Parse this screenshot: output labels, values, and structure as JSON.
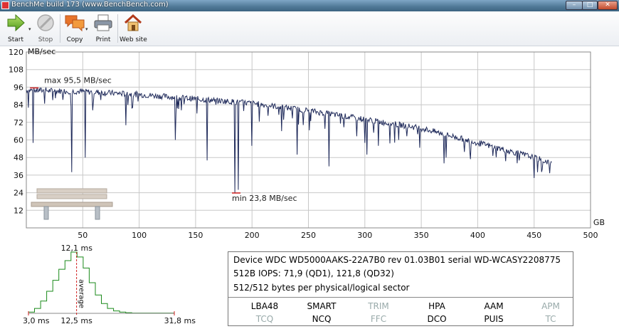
{
  "window": {
    "title": "BenchMe build 173 (www.BenchBench.com)",
    "min_label": "–",
    "max_label": "□",
    "close_label": "✕"
  },
  "toolbar": {
    "start": "Start",
    "stop": "Stop",
    "copy": "Copy",
    "print": "Print",
    "website": "Web site"
  },
  "colors": {
    "grid": "#c8c8c8",
    "series": "#1f2a5a",
    "marker": "#d02020",
    "histogram": "#1a8a1a",
    "average": "#d02020"
  },
  "chart_data": [
    {
      "type": "line",
      "ylabel": "MB/sec",
      "xlabel": "GB",
      "ylim": [
        0,
        120
      ],
      "xlim": [
        0,
        500
      ],
      "yticks": [
        12,
        24,
        36,
        48,
        60,
        72,
        84,
        96,
        108,
        120
      ],
      "xticks": [
        50,
        100,
        150,
        200,
        250,
        300,
        350,
        400,
        450,
        500
      ],
      "grid": true,
      "trend": {
        "x": [
          0,
          50,
          100,
          150,
          200,
          250,
          300,
          350,
          400,
          450,
          466
        ],
        "y": [
          94,
          93,
          91,
          88,
          85,
          80,
          74,
          68,
          58,
          48,
          44
        ]
      },
      "dips": {
        "x": [
          2,
          6,
          40,
          52,
          88,
          132,
          160,
          185,
          188,
          200,
          226,
          240,
          268,
          300,
          302,
          312,
          330,
          370,
          372,
          393,
          400,
          450,
          453,
          457
        ],
        "y": [
          82,
          58,
          38,
          48,
          70,
          60,
          46,
          24,
          26,
          56,
          66,
          50,
          42,
          58,
          50,
          56,
          60,
          44,
          48,
          52,
          58,
          34,
          38,
          40
        ]
      },
      "max_label": "max 95,5 MB/sec",
      "min_label": "min 23,8 MB/sec",
      "max_point": {
        "x": 7,
        "y": 95.5
      },
      "min_point": {
        "x": 186,
        "y": 23.8
      }
    },
    {
      "type": "area",
      "title": "12,1 ms",
      "x_range": [
        3.0,
        31.8
      ],
      "x_label_left": "3,0 ms",
      "x_label_mid": "12,5 ms",
      "x_label_right": "31,8 ms",
      "average_label": "average",
      "average_x": 12.5,
      "bins_x": [
        3.0,
        4.2,
        5.4,
        6.6,
        7.8,
        9.0,
        10.2,
        11.4,
        12.6,
        13.8,
        15.0,
        16.2,
        17.4,
        18.6,
        19.8,
        21.0,
        22.2,
        23.4,
        31.8
      ],
      "bins_y": [
        0.02,
        0.08,
        0.2,
        0.36,
        0.54,
        0.72,
        0.86,
        1.0,
        0.92,
        0.74,
        0.5,
        0.3,
        0.16,
        0.08,
        0.04,
        0.02,
        0.01,
        0.005,
        0
      ]
    }
  ],
  "device": {
    "line1": "Device WDC WD5000AAKS-22A7B0 rev 01.03B01 serial WD-WCASY2208775",
    "line2": "512B IOPS: 71,9 (QD1), 121,8 (QD32)",
    "line3": "512/512 bytes per physical/logical sector"
  },
  "features": [
    {
      "label": "LBA48",
      "on": true
    },
    {
      "label": "SMART",
      "on": true
    },
    {
      "label": "TRIM",
      "on": false
    },
    {
      "label": "HPA",
      "on": true
    },
    {
      "label": "AAM",
      "on": true
    },
    {
      "label": "APM",
      "on": false
    },
    {
      "label": "TCQ",
      "on": false
    },
    {
      "label": "NCQ",
      "on": true
    },
    {
      "label": "FFC",
      "on": false
    },
    {
      "label": "DCO",
      "on": true
    },
    {
      "label": "PUIS",
      "on": true
    },
    {
      "label": "TC",
      "on": false
    }
  ]
}
